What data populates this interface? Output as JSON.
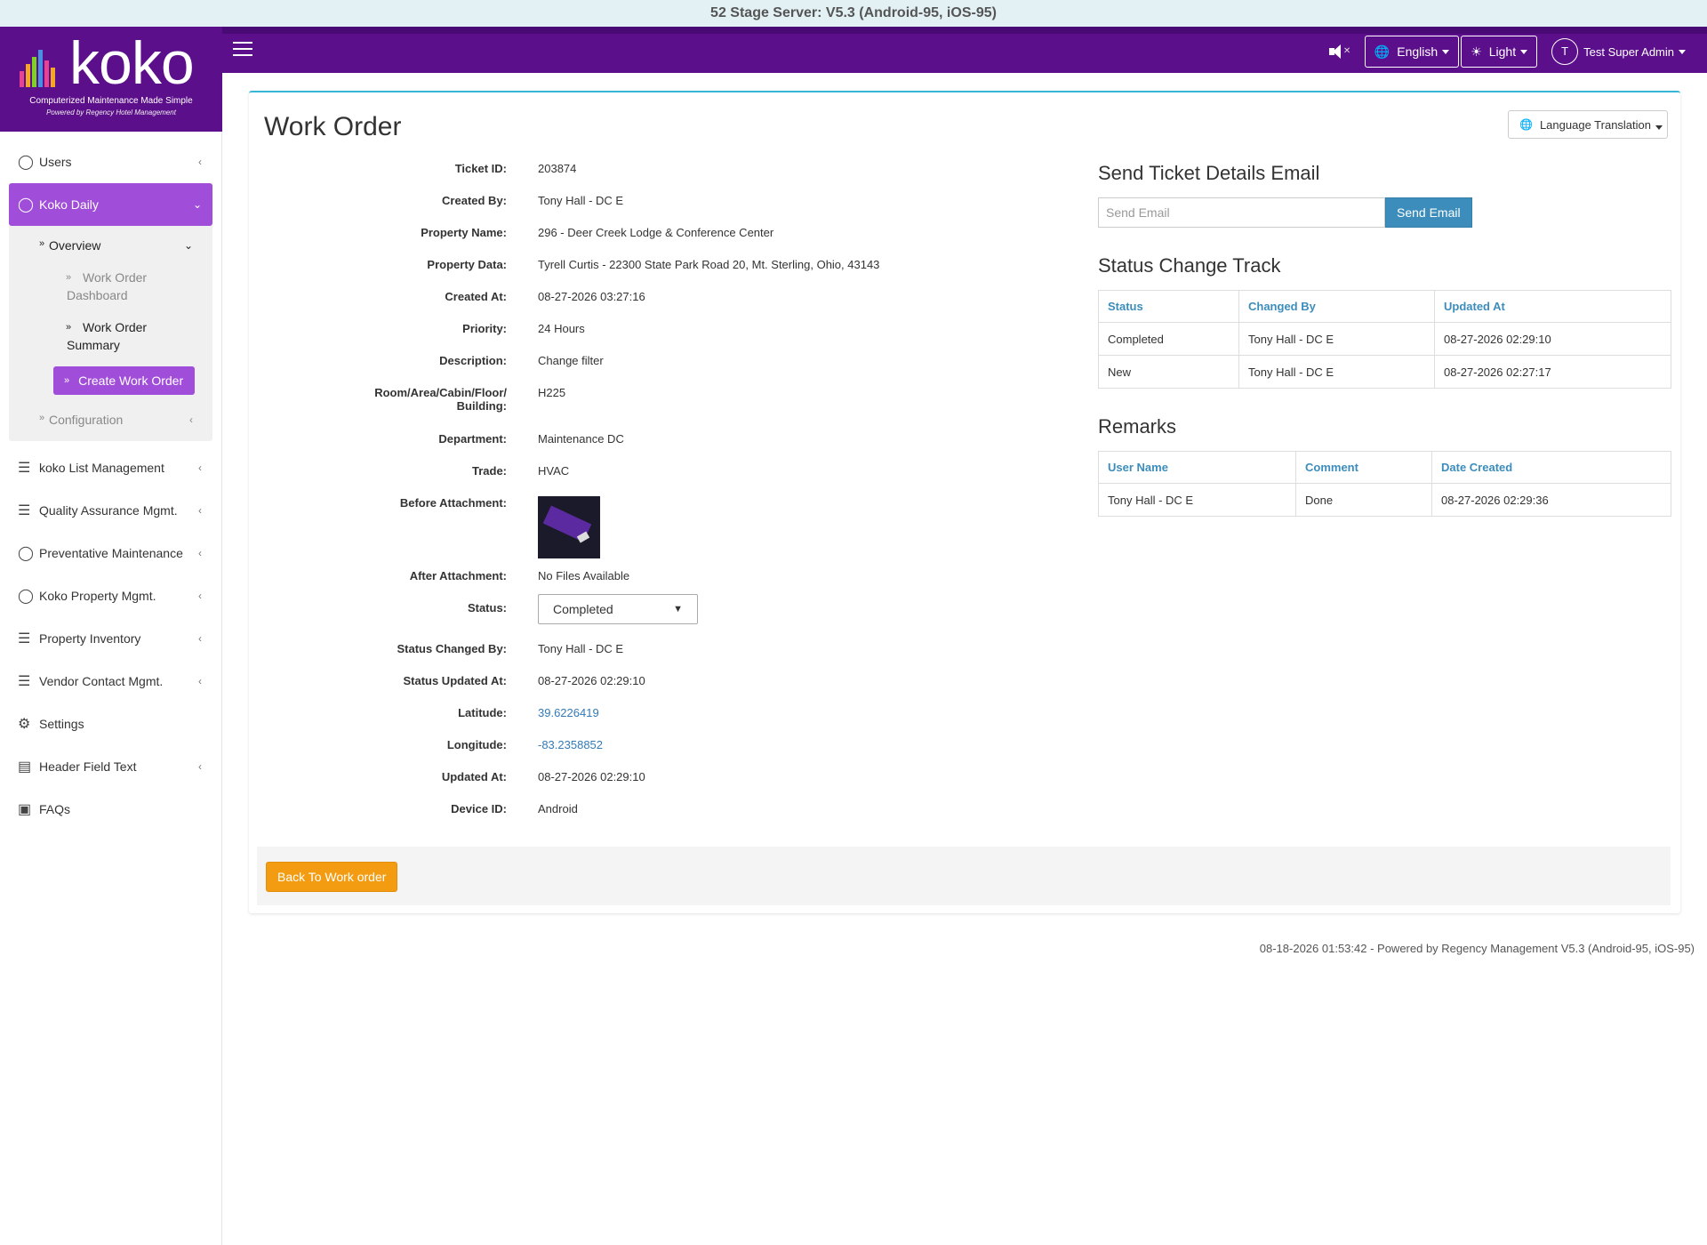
{
  "banner": {
    "text": "52 Stage Server: V5.3 (Android-95, iOS-95)"
  },
  "topnav": {
    "language": "English",
    "theme": "Light",
    "avatar_initial": "T",
    "user": "Test Super Admin"
  },
  "logo": {
    "word": "koko",
    "tagline": "Computerized Maintenance Made Simple",
    "powered": "Powered by Regency Hotel Management"
  },
  "sidebar": {
    "items": [
      {
        "label": "Users"
      },
      {
        "label": "Koko Daily"
      },
      {
        "label": "koko List Management"
      },
      {
        "label": "Quality Assurance Mgmt."
      },
      {
        "label": "Preventative Maintenance"
      },
      {
        "label": "Koko Property Mgmt."
      },
      {
        "label": "Property Inventory"
      },
      {
        "label": "Vendor Contact Mgmt."
      },
      {
        "label": "Settings"
      },
      {
        "label": "Header Field Text"
      },
      {
        "label": "FAQs"
      }
    ],
    "overview": "Overview",
    "work_order_dashboard": "Work Order Dashboard",
    "work_order_summary": "Work Order Summary",
    "create_work_order": "Create Work Order",
    "configuration": "Configuration"
  },
  "main": {
    "title": "Work Order",
    "language_translation": "Language Translation",
    "details": {
      "ticket_id_label": "Ticket ID:",
      "ticket_id": "203874",
      "created_by_label": "Created By:",
      "created_by": "Tony Hall - DC E",
      "property_name_label": "Property Name:",
      "property_name": "296 - Deer Creek Lodge & Conference Center",
      "property_data_label": "Property Data:",
      "property_data": "Tyrell Curtis - 22300 State Park Road 20, Mt. Sterling, Ohio, 43143",
      "created_at_label": "Created At:",
      "created_at": "08-27-2026 03:27:16",
      "priority_label": "Priority:",
      "priority": "24 Hours",
      "description_label": "Description:",
      "description": "Change filter",
      "room_label_1": "Room/Area/Cabin/Floor/",
      "room_label_2": "Building:",
      "room": "H225",
      "department_label": "Department:",
      "department": "Maintenance DC",
      "trade_label": "Trade:",
      "trade": "HVAC",
      "before_attachment_label": "Before Attachment:",
      "after_attachment_label": "After Attachment:",
      "after_attachment": "No Files Available",
      "status_label": "Status:",
      "status": "Completed",
      "status_changed_by_label": "Status Changed By:",
      "status_changed_by": "Tony Hall - DC E",
      "status_updated_at_label": "Status Updated At:",
      "status_updated_at": "08-27-2026 02:29:10",
      "latitude_label": "Latitude:",
      "latitude": "39.6226419",
      "longitude_label": "Longitude:",
      "longitude": "-83.2358852",
      "updated_at_label": "Updated At:",
      "updated_at": "08-27-2026 02:29:10",
      "device_id_label": "Device ID:",
      "device_id": "Android"
    },
    "email": {
      "title": "Send Ticket Details Email",
      "placeholder": "Send Email",
      "button": "Send Email"
    },
    "status_track": {
      "title": "Status Change Track",
      "headers": [
        "Status",
        "Changed By",
        "Updated At"
      ],
      "rows": [
        [
          "Completed",
          "Tony Hall - DC E",
          "08-27-2026 02:29:10"
        ],
        [
          "New",
          "Tony Hall - DC E",
          "08-27-2026 02:27:17"
        ]
      ]
    },
    "remarks": {
      "title": "Remarks",
      "headers": [
        "User Name",
        "Comment",
        "Date Created"
      ],
      "rows": [
        [
          "Tony Hall - DC E",
          "Done",
          "08-27-2026 02:29:36"
        ]
      ]
    },
    "back_button": "Back To Work order"
  },
  "footer": {
    "text": "08-18-2026 01:53:42 - Powered by Regency Management V5.3 (Android-95, iOS-95)"
  },
  "colors": {
    "brand_purple": "#5c0f8b",
    "active_purple": "#a04dd9",
    "accent_blue": "#3c8dbc",
    "back_orange": "#f39c12"
  }
}
